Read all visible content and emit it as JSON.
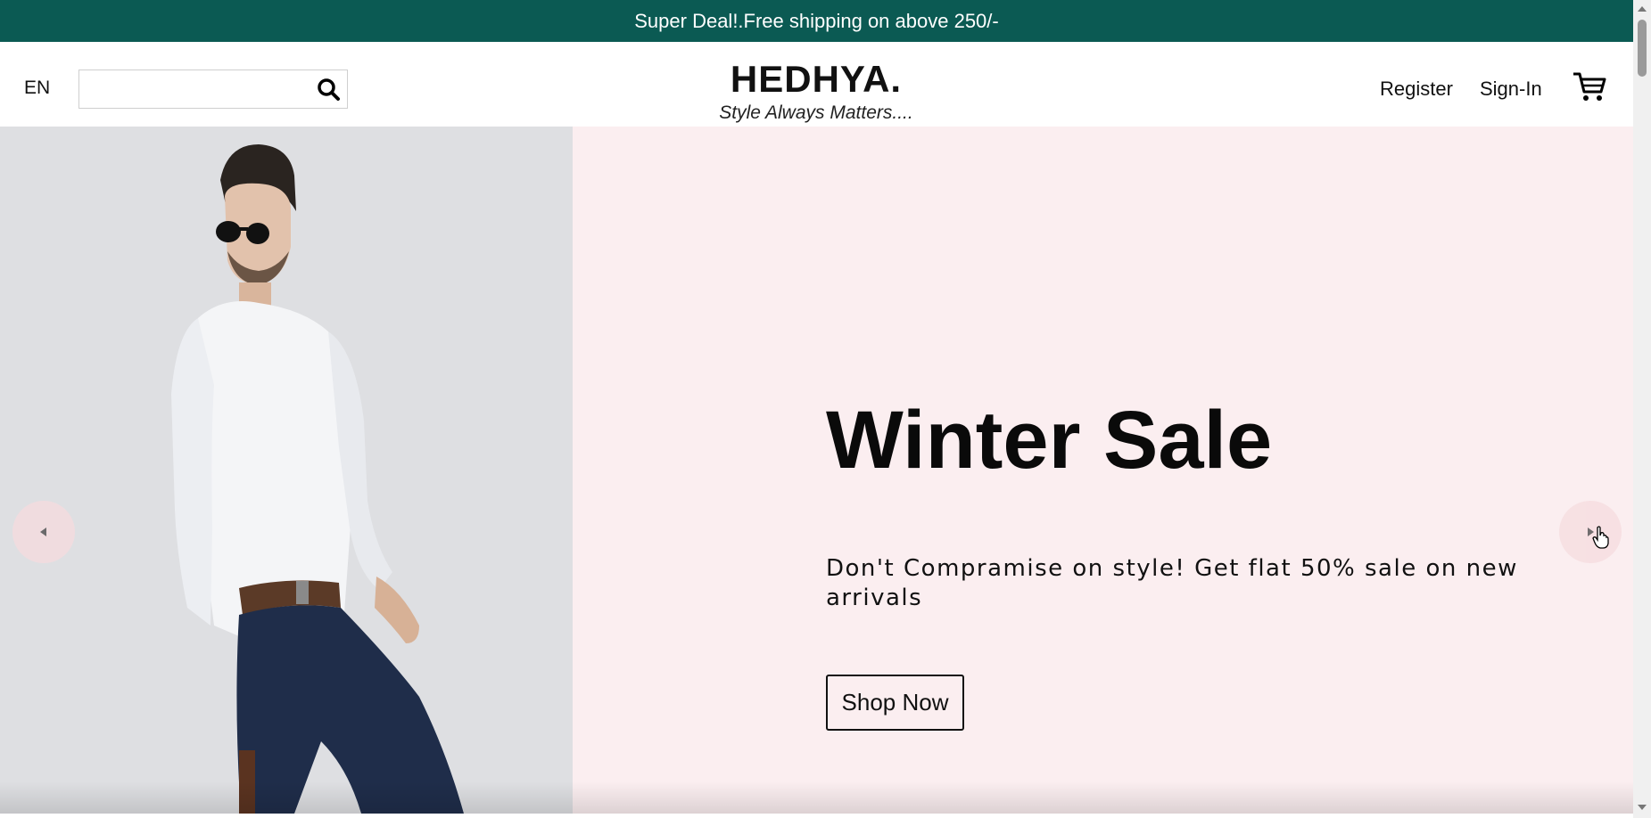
{
  "announcement": {
    "text": "Super Deal!.Free shipping on above 250/-"
  },
  "header": {
    "language": "EN",
    "search": {
      "value": "",
      "placeholder": ""
    },
    "logo": "HEDHYA.",
    "tagline": "Style Always Matters....",
    "register_label": "Register",
    "signin_label": "Sign-In",
    "icons": {
      "search": "search-icon",
      "cart": "cart-icon"
    }
  },
  "hero": {
    "title": "Winter Sale",
    "description": "Don't Compramise on style! Get flat 50% sale on new arrivals",
    "button_label": "Shop Now",
    "image": "man-in-white-shirt-photo",
    "icons": {
      "prev": "arrow-left-icon",
      "next": "arrow-right-icon"
    }
  },
  "colors": {
    "announcement_bg": "#0b5a53",
    "hero_bg": "#fbeef0",
    "image_bg": "#dedfe2"
  }
}
